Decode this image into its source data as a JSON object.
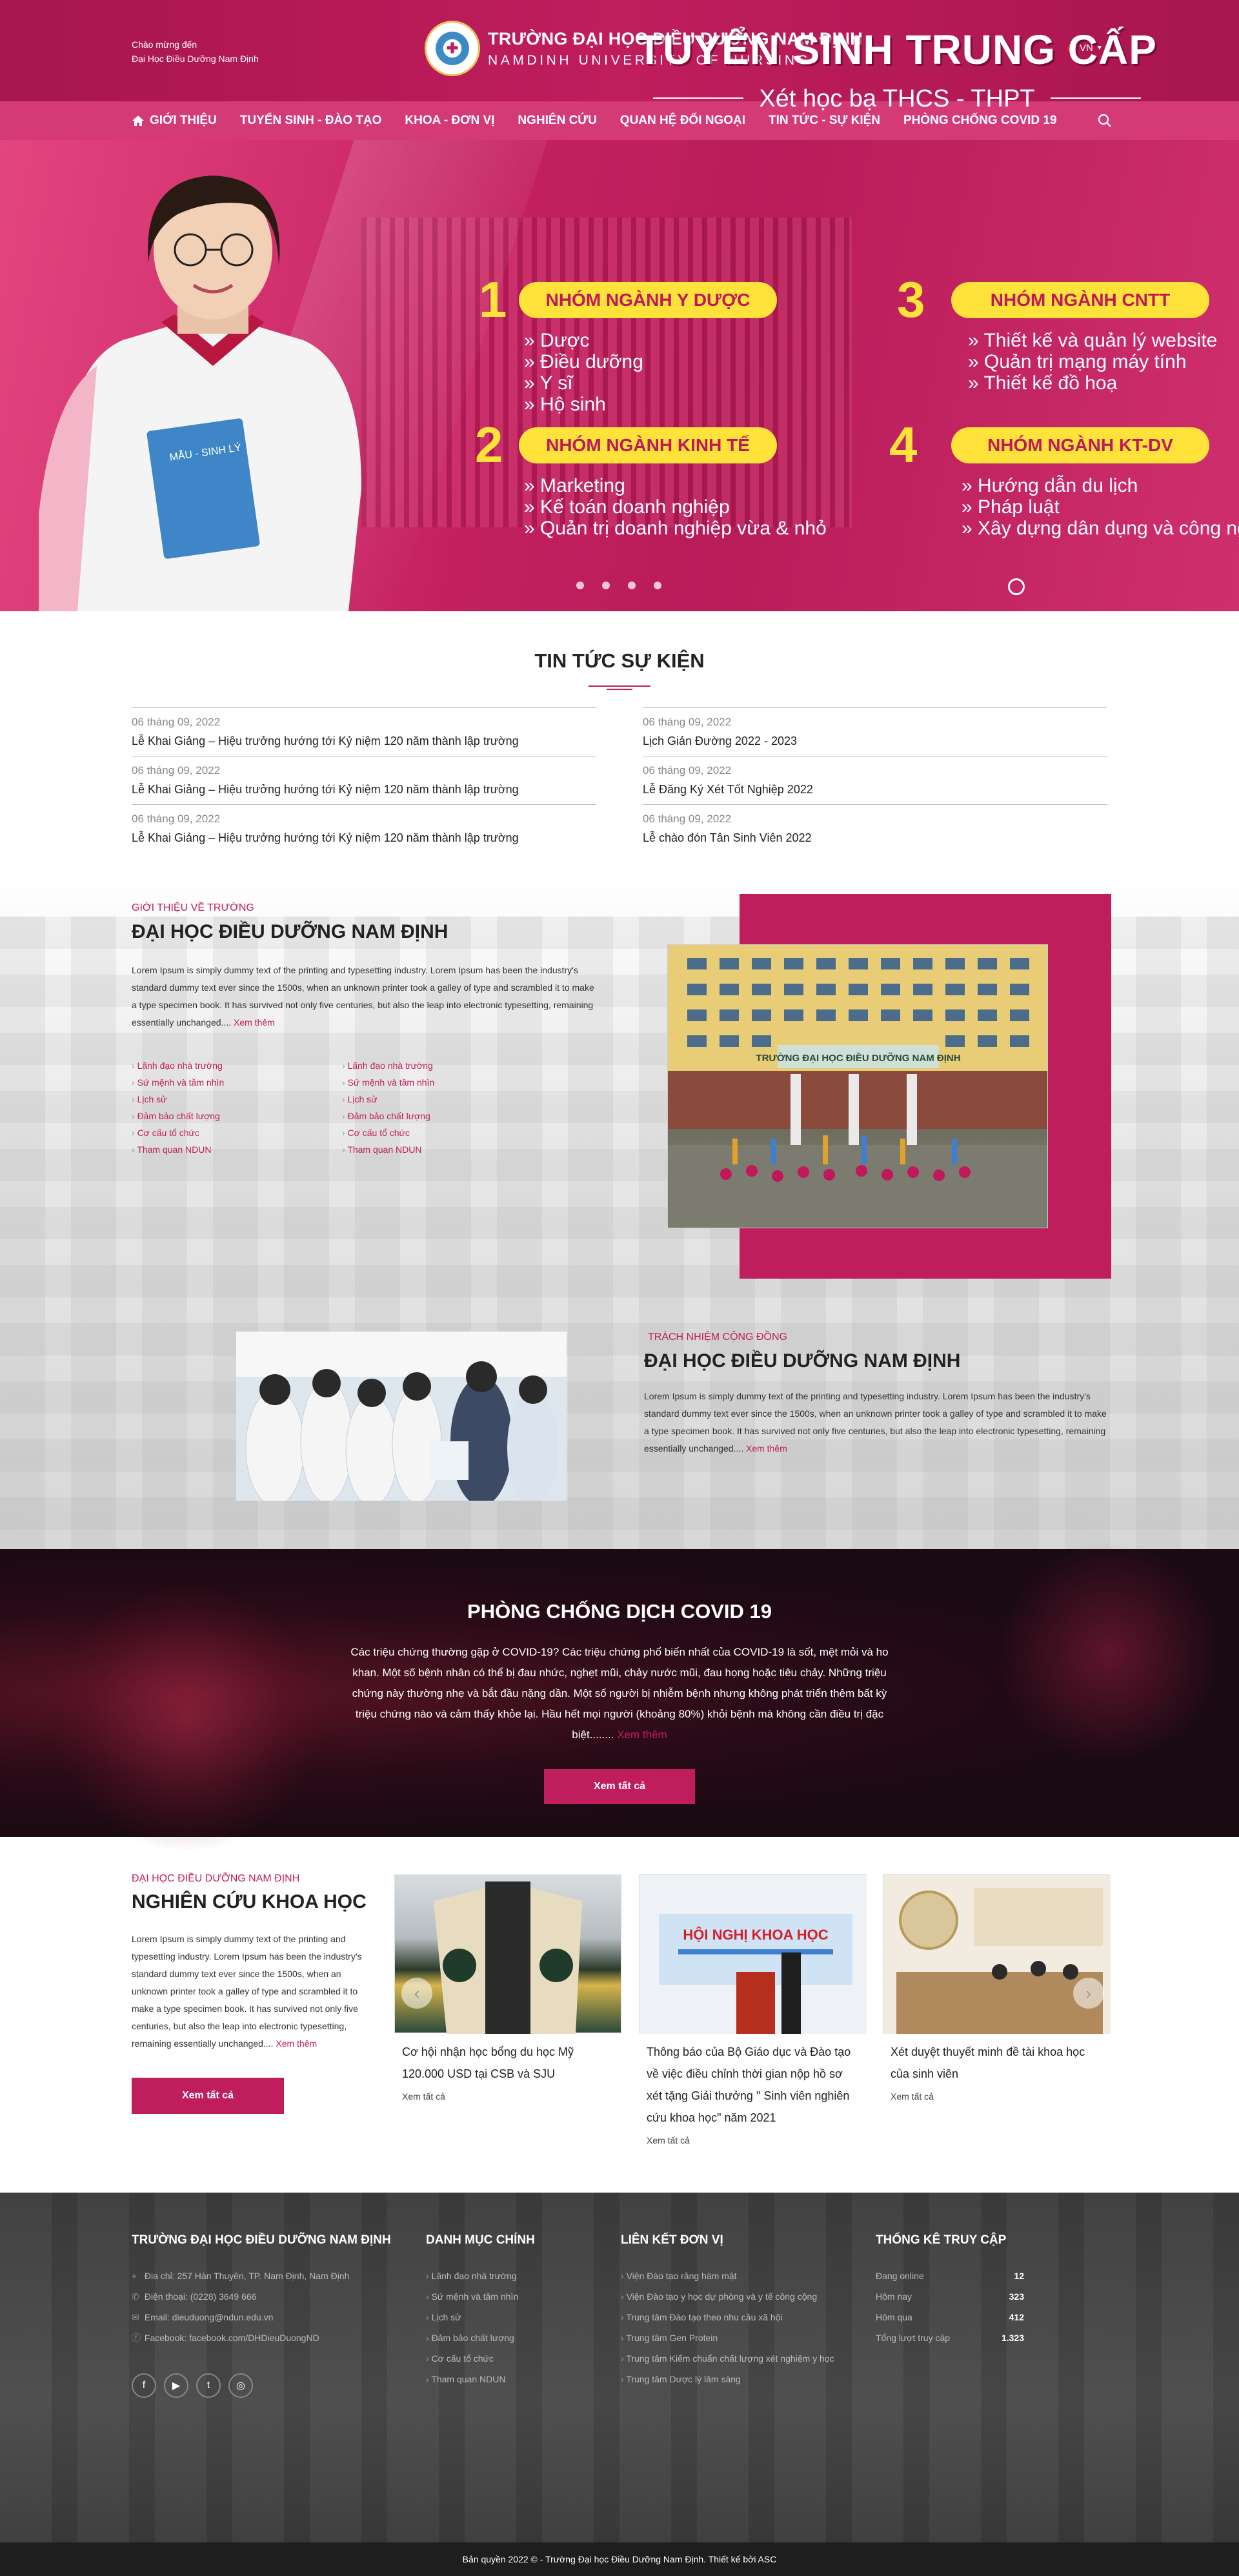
{
  "header": {
    "welcome_line1": "Chào mừng đến",
    "welcome_line2": "Đại Học Điều Dưỡng Nam Định",
    "logo_vn": "TRƯỜNG ĐẠI HỌC ĐIỀU DƯỠNG NAM ĐỊNH",
    "logo_en": "NAMDINH UNIVERSITY OF NURSING",
    "language": "VN"
  },
  "nav": {
    "items": [
      {
        "label": "GIỚI THIỆU"
      },
      {
        "label": "TUYỂN SINH - ĐÀO TẠO"
      },
      {
        "label": "KHOA - ĐƠN VỊ"
      },
      {
        "label": "NGHIÊN CỨU"
      },
      {
        "label": "QUAN HỆ ĐỐI NGOẠI"
      },
      {
        "label": "TIN TỨC - SỰ KIỆN"
      },
      {
        "label": "PHÒNG CHỐNG COVID 19"
      }
    ]
  },
  "banner": {
    "title": "TUYỂN SINH TRUNG CẤP",
    "subtitle": "Xét học bạ THCS - THPT",
    "book_label": "MẪU - SINH LÝ",
    "groups": [
      {
        "num": "1",
        "name": "NHÓM NGÀNH Y DƯỢC",
        "items": [
          "Dược",
          "Điều dưỡng",
          "Y sĩ",
          "Hộ sinh"
        ]
      },
      {
        "num": "2",
        "name": "NHÓM NGÀNH KINH TẾ",
        "items": [
          "Marketing",
          "Kế toán doanh nghiệp",
          "Quản trị doanh nghiệp vừa & nhỏ"
        ]
      },
      {
        "num": "3",
        "name": "NHÓM NGÀNH CNTT",
        "items": [
          "Thiết kế và quản lý website",
          "Quản trị mạng máy tính",
          "Thiết kế đồ hoạ"
        ]
      },
      {
        "num": "4",
        "name": "NHÓM NGÀNH KT-DV",
        "items": [
          "Hướng dẫn du lịch",
          "Pháp luật",
          "Xây dựng dân dụng và công ng"
        ]
      }
    ]
  },
  "news": {
    "title": "TIN TỨC SỰ KIỆN",
    "left": [
      {
        "date": "06 tháng 09, 2022",
        "title": "Lễ Khai Giảng – Hiệu trưởng hướng tới Kỷ niệm  120 năm thành lập trường"
      },
      {
        "date": "06 tháng 09, 2022",
        "title": "Lễ Khai Giảng – Hiệu trưởng hướng tới Kỷ niệm  120 năm thành lập trường"
      },
      {
        "date": "06 tháng 09, 2022",
        "title": "Lễ Khai Giảng – Hiệu trưởng hướng tới Kỷ niệm  120 năm thành lập trường"
      }
    ],
    "right": [
      {
        "date": "06 tháng 09, 2022",
        "title": "Lịch Giản Đường 2022 - 2023"
      },
      {
        "date": "06 tháng 09, 2022",
        "title": "Lễ Đăng Ký Xét Tốt Nghiệp 2022"
      },
      {
        "date": "06 tháng 09, 2022",
        "title": "Lễ chào đón Tân Sinh Viên 2022"
      }
    ]
  },
  "intro": {
    "kicker": "GIỚI THIỆU VỀ TRƯỜNG",
    "heading": "ĐẠI HỌC ĐIỀU DƯỠNG NAM ĐỊNH",
    "text": "Lorem Ipsum is simply dummy text of the printing and typesetting industry. Lorem Ipsum has been the industry's standard dummy text ever since the 1500s, when an unknown printer took a galley of type and scrambled it to make a type specimen book. It has survived not only five centuries, but also the leap into electronic typesetting, remaining essentially unchanged....",
    "more": "Xem thêm",
    "links_left": [
      "Lãnh đạo nhà trường",
      "Sứ mệnh và tầm nhìn",
      "Lịch sử",
      "Đảm bảo chất lượng",
      "Cơ cấu tổ chức",
      "Tham quan NDUN"
    ],
    "links_right": [
      "Lãnh đạo nhà trường",
      "Sứ mệnh và tầm nhìn",
      "Lịch sử",
      "Đảm bảo chất lượng",
      "Cơ cấu tổ chức",
      "Tham quan NDUN"
    ],
    "photo_sign": "TRƯỜNG ĐẠI HỌC ĐIỀU DƯỠNG NAM ĐỊNH"
  },
  "community": {
    "kicker": "TRÁCH NHIỆM CỘNG ĐỒNG",
    "heading": "ĐẠI HỌC ĐIỀU DƯỠNG NAM ĐỊNH",
    "text": "Lorem Ipsum is simply dummy text of the printing and typesetting industry. Lorem Ipsum has been the industry's standard dummy text ever since the 1500s, when an unknown printer took a galley of type and scrambled it to make a type specimen book. It has survived not only five centuries, but also the leap into electronic typesetting, remaining essentially unchanged....",
    "more": "Xem thêm"
  },
  "covid": {
    "title": "PHÒNG CHỐNG DỊCH COVID 19",
    "text": "Các triệu chứng thường gặp ở COVID-19? Các triệu chứng phổ biến nhất của COVID-19 là sốt, mệt mỏi và ho khan. Một số bệnh nhân có thể bị đau nhức, nghẹt mũi, chảy nước mũi, đau họng hoặc tiêu chảy. Những triệu chứng này thường nhẹ và bắt đầu nặng dần. Một số người bị nhiễm bệnh nhưng không phát triển thêm bất kỳ triệu chứng nào và cảm thấy khỏe lại. Hầu hết mọi người (khoảng 80%) khỏi bệnh mà không cần điều trị đặc biệt........",
    "more": "Xem thêm",
    "button": "Xem tất cả"
  },
  "research": {
    "kicker": "ĐẠI HỌC ĐIỀU DƯỠNG NAM ĐỊNH",
    "heading": "NGHIÊN CỨU KHOA HỌC",
    "text": "Lorem Ipsum is simply dummy text of the printing and typesetting industry. Lorem Ipsum has been the industry's standard dummy text ever since the 1500s, when an unknown printer took a galley of type and scrambled it to make a type specimen book. It has survived not only five centuries, but also the leap into electronic typesetting, remaining essentially unchanged....",
    "more": "Xem thêm",
    "button": "Xem tất cả",
    "cards": [
      {
        "title": "Cơ hội nhận học bổng du học Mỹ 120.000 USD tại CSB và SJU",
        "more": "Xem tất cả"
      },
      {
        "title": "Thông báo của Bộ Giáo dục và Đào tạo về việc điều chỉnh thời gian nộp hồ sơ xét tặng Giải thưởng \" Sinh viên nghiên cứu khoa học\" năm 2021",
        "more": "Xem tất cả",
        "banner_text": "HỘI NGHỊ KHOA HỌC"
      },
      {
        "title": "Xét duyệt thuyết minh đề tài khoa học của sinh viên",
        "more": "Xem tất cả"
      }
    ]
  },
  "footer": {
    "col1_title": "TRƯỜNG ĐẠI HỌC ĐIỀU DƯỠNG NAM ĐỊNH",
    "address": "Địa chỉ: 257 Hàn Thuyên, TP. Nam Định, Nam Định",
    "phone": "Điện thoại: (0228) 3649 666",
    "email": "Email: dieuduong@ndun.edu.vn",
    "facebook": "Facebook: facebook.com/DHDieuDuongND",
    "col2_title": "DANH MỤC CHÍNH",
    "col2_items": [
      "Lãnh đạo nhà trường",
      "Sứ mệnh và tầm nhìn",
      "Lịch sử",
      "Đảm bảo chất lượng",
      "Cơ cấu tổ chức",
      "Tham quan NDUN"
    ],
    "col3_title": "LIÊN KẾT ĐƠN VỊ",
    "col3_items": [
      "Viện Đào tạo răng hàm mặt",
      "Viện Đào tạo y học dự phòng và y tế công cộng",
      "Trung tâm Đào tạo theo nhu cầu xã hội",
      "Trung tâm Gen Protein",
      "Trung tâm Kiểm chuẩn chất lượng xét nghiệm y học",
      "Trung tâm Dược lý lâm sàng"
    ],
    "col4_title": "THỐNG KÊ TRUY CẬP",
    "stats": [
      {
        "label": "Đang online",
        "value": "12"
      },
      {
        "label": "Hôm nay",
        "value": "323"
      },
      {
        "label": "Hôm qua",
        "value": "412"
      },
      {
        "label": "Tổng lượt truy cập",
        "value": "1.323"
      }
    ],
    "copyright": "Bản quyền 2022 © - Trường Đại học Điều Dưỡng Nam Định. Thiết kế bởi ASC"
  }
}
